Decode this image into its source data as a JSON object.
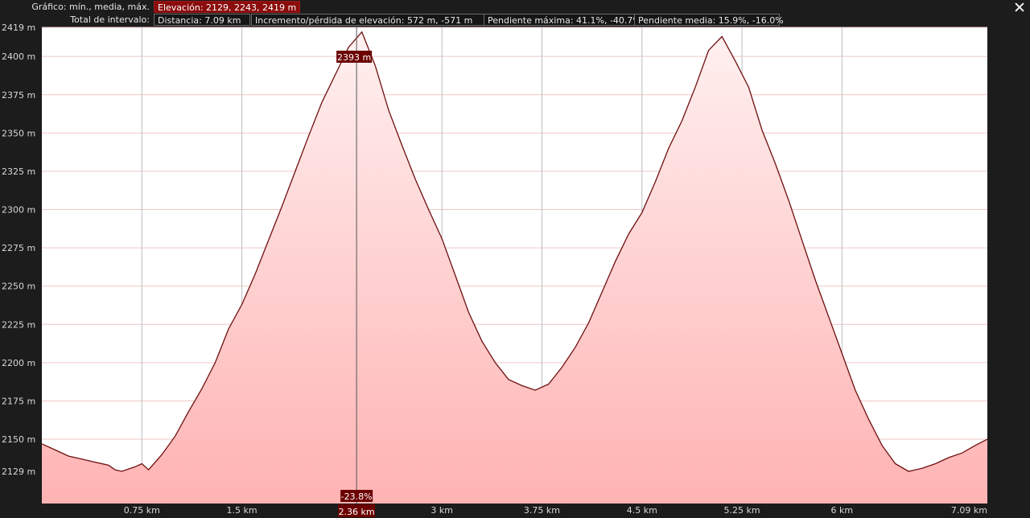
{
  "header": {
    "row1_label": "Gráfico: mín., media, máx.",
    "elevation_summary": "Elevación: 2129, 2243, 2419 m",
    "row2_label": "Total de intervalo:",
    "distance": "Distancia: 7.09 km",
    "gain_loss": "Incremento/pérdida de elevación: 572 m, -571 m",
    "max_slope": "Pendiente máxima: 41.1%, -40.7%",
    "avg_slope": "Pendiente media: 15.9%, -16.0%"
  },
  "cursor": {
    "elevation_label": "2393 m",
    "slope_label": "-23.8%",
    "distance_label": "2.36 km",
    "distance_km": 2.36
  },
  "colors": {
    "line": "#6e0f0f",
    "fill_top": "#fff0f0",
    "fill_bottom": "#ffb3b3",
    "tag_bg": "#6b0000"
  },
  "chart_data": {
    "type": "area",
    "xlabel": "",
    "ylabel": "",
    "xlim": [
      0,
      7.09
    ],
    "ylim": [
      2108,
      2419
    ],
    "grid": true,
    "yticks": [
      {
        "value": 2419,
        "label": "2419 m"
      },
      {
        "value": 2400,
        "label": "2400 m"
      },
      {
        "value": 2375,
        "label": "2375 m"
      },
      {
        "value": 2350,
        "label": "2350 m"
      },
      {
        "value": 2325,
        "label": "2325 m"
      },
      {
        "value": 2300,
        "label": "2300 m"
      },
      {
        "value": 2275,
        "label": "2275 m"
      },
      {
        "value": 2250,
        "label": "2250 m"
      },
      {
        "value": 2225,
        "label": "2225 m"
      },
      {
        "value": 2200,
        "label": "2200 m"
      },
      {
        "value": 2175,
        "label": "2175 m"
      },
      {
        "value": 2150,
        "label": "2150 m"
      },
      {
        "value": 2129,
        "label": "2129 m"
      }
    ],
    "xticks": [
      {
        "value": 0.75,
        "label": "0.75 km"
      },
      {
        "value": 1.5,
        "label": "1.5 km"
      },
      {
        "value": 3,
        "label": "3 km"
      },
      {
        "value": 3.75,
        "label": "3.75 km"
      },
      {
        "value": 4.5,
        "label": "4.5 km"
      },
      {
        "value": 5.25,
        "label": "5.25 km"
      },
      {
        "value": 6,
        "label": "6 km"
      },
      {
        "value": 7.09,
        "label": "7.09 km"
      }
    ],
    "x": [
      0,
      0.1,
      0.2,
      0.3,
      0.4,
      0.5,
      0.55,
      0.6,
      0.7,
      0.75,
      0.8,
      0.9,
      1.0,
      1.1,
      1.2,
      1.3,
      1.4,
      1.5,
      1.6,
      1.7,
      1.8,
      1.9,
      2.0,
      2.1,
      2.2,
      2.3,
      2.4,
      2.5,
      2.6,
      2.7,
      2.8,
      2.9,
      3.0,
      3.1,
      3.2,
      3.3,
      3.4,
      3.5,
      3.6,
      3.7,
      3.8,
      3.9,
      4.0,
      4.1,
      4.2,
      4.3,
      4.4,
      4.5,
      4.6,
      4.7,
      4.8,
      4.9,
      5.0,
      5.1,
      5.2,
      5.3,
      5.4,
      5.5,
      5.6,
      5.7,
      5.8,
      5.9,
      6.0,
      6.1,
      6.2,
      6.3,
      6.4,
      6.5,
      6.6,
      6.7,
      6.8,
      6.9,
      7.0,
      7.09
    ],
    "values": [
      2147,
      2143,
      2139,
      2137,
      2135,
      2133,
      2130,
      2129,
      2132,
      2134,
      2130,
      2140,
      2152,
      2168,
      2183,
      2200,
      2222,
      2238,
      2258,
      2280,
      2302,
      2325,
      2348,
      2370,
      2388,
      2406,
      2416,
      2394,
      2365,
      2342,
      2320,
      2300,
      2281,
      2257,
      2233,
      2214,
      2200,
      2189,
      2185,
      2182,
      2186,
      2197,
      2210,
      2226,
      2246,
      2266,
      2284,
      2298,
      2318,
      2340,
      2358,
      2380,
      2404,
      2413,
      2397,
      2380,
      2352,
      2330,
      2306,
      2280,
      2254,
      2230,
      2206,
      2182,
      2163,
      2146,
      2134,
      2129,
      2131,
      2134,
      2138,
      2141,
      2146,
      2150
    ]
  }
}
